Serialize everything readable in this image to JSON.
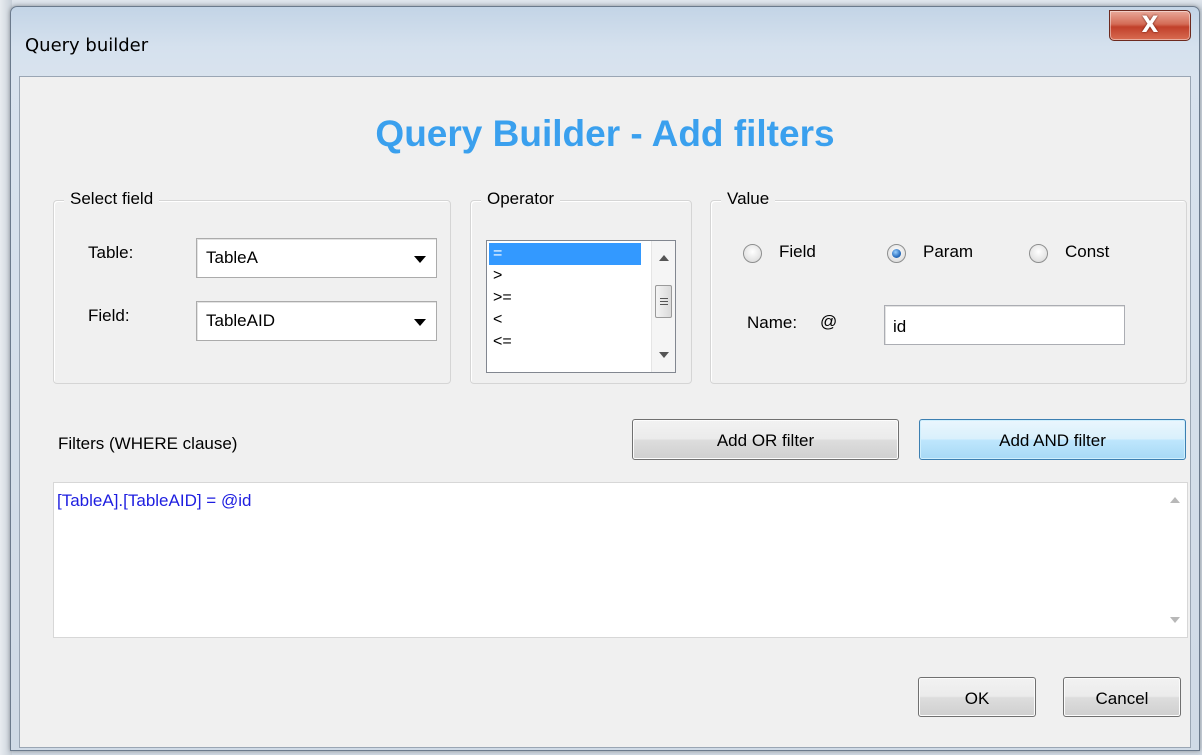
{
  "window": {
    "title": "Query builder",
    "close_glyph": "X"
  },
  "heading": "Query Builder - Add filters",
  "select_field": {
    "legend": "Select field",
    "table_label": "Table:",
    "table_value": "TableA",
    "field_label": "Field:",
    "field_value": "TableAID"
  },
  "operator": {
    "legend": "Operator",
    "items": [
      "=",
      ">",
      ">=",
      "<",
      "<="
    ],
    "selected": "="
  },
  "value": {
    "legend": "Value",
    "options": [
      {
        "label": "Field",
        "checked": false
      },
      {
        "label": "Param",
        "checked": true
      },
      {
        "label": "Const",
        "checked": false
      }
    ],
    "name_label": "Name:",
    "name_prefix": "@",
    "name_value": "id"
  },
  "filters": {
    "label": "Filters (WHERE clause)",
    "add_or_label": "Add OR filter",
    "add_and_label": "Add AND filter",
    "text": "[TableA].[TableAID] = @id"
  },
  "footer": {
    "ok_label": "OK",
    "cancel_label": "Cancel"
  },
  "colors": {
    "heading": "#3aa0ee",
    "selection": "#3399ff",
    "filter_text": "#1e1ee0",
    "close_button": "#c9442d"
  }
}
